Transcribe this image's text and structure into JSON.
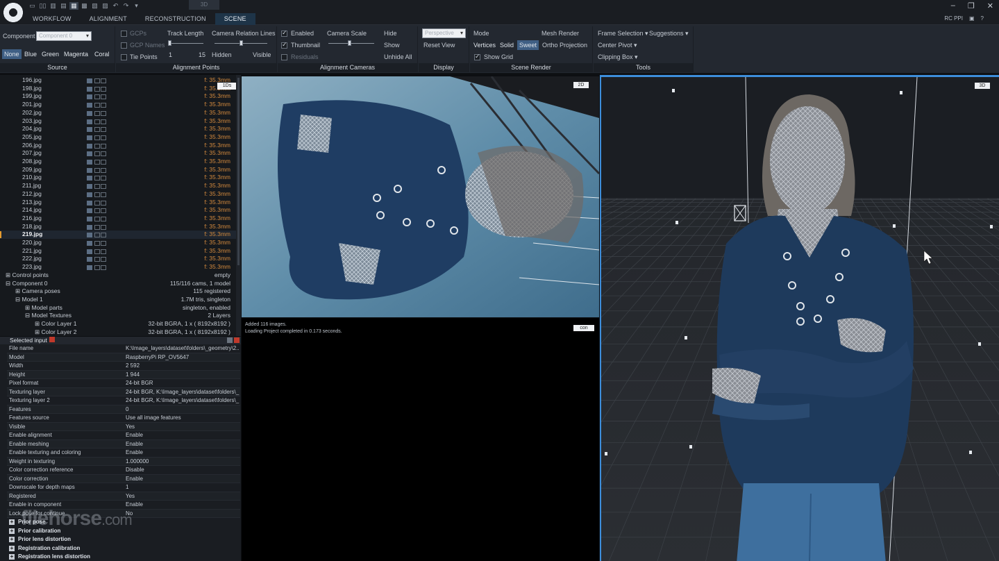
{
  "app": {
    "tab_hint": "3D",
    "menu_tabs": [
      "WORKFLOW",
      "ALIGNMENT",
      "RECONSTRUCTION",
      "SCENE"
    ],
    "active_tab": "SCENE",
    "window_controls": [
      "–",
      "❐",
      "✕"
    ],
    "right_corner": [
      "RC PPI",
      "▣",
      "?"
    ]
  },
  "ribbon": {
    "source": {
      "label": "Source",
      "component_label": "Component",
      "component_value": "Component 0",
      "colors": [
        "None",
        "Blue",
        "Green",
        "Magenta",
        "Coral"
      ],
      "selected_color": "None"
    },
    "alignment_points": {
      "label": "Alignment Points",
      "gcps": "GCPs",
      "gcp_names": "GCP Names",
      "tie_points": "Tie Points",
      "track_length": "Track Length",
      "track_min": "1",
      "track_max": "15",
      "camera_relation_lines": "Camera Relation Lines",
      "hidden": "Hidden",
      "visible": "Visible"
    },
    "alignment_cameras": {
      "label": "Alignment Cameras",
      "enabled": "Enabled",
      "thumbnail": "Thumbnail",
      "residuals": "Residuals",
      "camera_scale": "Camera Scale",
      "hide": "Hide",
      "show": "Show",
      "unhide_all": "Unhide All"
    },
    "display": {
      "label": "Display",
      "projection_value": "Perspective",
      "reset_view": "Reset View"
    },
    "scene_render": {
      "label": "Scene Render",
      "mode": "Mode",
      "mesh_render": "Mesh Render",
      "vertices": "Vertices",
      "solid": "Solid",
      "sweet": "Sweet",
      "ortho_projection": "Ortho Projection",
      "show_grid": "Show Grid"
    },
    "tools": {
      "label": "Tools",
      "frame_selection": "Frame Selection",
      "suggestions": "Suggestions",
      "center_pivot": "Center Pivot",
      "clipping_box": "Clipping Box"
    }
  },
  "tree": {
    "badge": "1Ds",
    "images": [
      {
        "name": "196.jpg",
        "focal": "f: 35.3mm"
      },
      {
        "name": "198.jpg",
        "focal": "f: 35.3mm"
      },
      {
        "name": "199.jpg",
        "focal": "f: 35.3mm"
      },
      {
        "name": "201.jpg",
        "focal": "f: 35.3mm"
      },
      {
        "name": "202.jpg",
        "focal": "f: 35.3mm"
      },
      {
        "name": "203.jpg",
        "focal": "f: 35.3mm"
      },
      {
        "name": "204.jpg",
        "focal": "f: 35.3mm"
      },
      {
        "name": "205.jpg",
        "focal": "f: 35.3mm"
      },
      {
        "name": "206.jpg",
        "focal": "f: 35.3mm"
      },
      {
        "name": "207.jpg",
        "focal": "f: 35.3mm"
      },
      {
        "name": "208.jpg",
        "focal": "f: 35.3mm"
      },
      {
        "name": "209.jpg",
        "focal": "f: 35.3mm"
      },
      {
        "name": "210.jpg",
        "focal": "f: 35.3mm"
      },
      {
        "name": "211.jpg",
        "focal": "f: 35.3mm"
      },
      {
        "name": "212.jpg",
        "focal": "f: 35.3mm"
      },
      {
        "name": "213.jpg",
        "focal": "f: 35.3mm"
      },
      {
        "name": "214.jpg",
        "focal": "f: 35.3mm"
      },
      {
        "name": "216.jpg",
        "focal": "f: 35.3mm"
      },
      {
        "name": "218.jpg",
        "focal": "f: 35.3mm"
      },
      {
        "name": "219.jpg",
        "focal": "f: 35.3mm"
      },
      {
        "name": "220.jpg",
        "focal": "f: 35.3mm"
      },
      {
        "name": "221.jpg",
        "focal": "f: 35.3mm"
      },
      {
        "name": "222.jpg",
        "focal": "f: 35.3mm"
      },
      {
        "name": "223.jpg",
        "focal": "f: 35.3mm"
      }
    ],
    "selected_image": "219.jpg",
    "structure": [
      {
        "name": "⊞ Control points",
        "value": "empty",
        "indent": 8
      },
      {
        "name": "⊟ Component 0",
        "value": "115/116 cams, 1 model",
        "indent": 8
      },
      {
        "name": "⊞ Camera poses",
        "value": "115 registered",
        "indent": 22
      },
      {
        "name": "⊟ Model 1",
        "value": "1.7M tris, singleton",
        "indent": 22
      },
      {
        "name": "⊞ Model parts",
        "value": "singleton, enabled",
        "indent": 36
      },
      {
        "name": "⊟ Model Textures",
        "value": "2 Layers",
        "indent": 36
      },
      {
        "name": "⊞ Color Layer 1",
        "value": "32-bit BGRA, 1 x ( 8192x8192 )",
        "indent": 50
      },
      {
        "name": "⊞ Color Layer 2",
        "value": "32-bit BGRA, 1 x ( 8192x8192 )",
        "indent": 50
      }
    ]
  },
  "properties": {
    "title": "Selected input",
    "rows": [
      {
        "k": "File name",
        "v": "K:\\Image_layers\\dataset\\folders\\_geometry\\2..."
      },
      {
        "k": "Model",
        "v": "RaspberryPi RP_OV5647"
      },
      {
        "k": "Width",
        "v": "2 592"
      },
      {
        "k": "Height",
        "v": "1 944"
      },
      {
        "k": "Pixel format",
        "v": "24-bit BGR"
      },
      {
        "k": "Texturing layer",
        "v": "24-bit BGR, K:\\Image_layers\\dataset\\folders\\_..."
      },
      {
        "k": "Texturing layer 2",
        "v": "24-bit BGR, K:\\Image_layers\\dataset\\folders\\_..."
      },
      {
        "k": "Features",
        "v": "0"
      },
      {
        "k": "Features source",
        "v": "Use all image features"
      },
      {
        "k": "Visible",
        "v": "Yes"
      },
      {
        "k": "Enable alignment",
        "v": "Enable"
      },
      {
        "k": "Enable meshing",
        "v": "Enable"
      },
      {
        "k": "Enable texturing and coloring",
        "v": "Enable"
      },
      {
        "k": "Weight in texturing",
        "v": "1.000000"
      },
      {
        "k": "Color correction reference",
        "v": "Disable"
      },
      {
        "k": "Color correction",
        "v": "Enable"
      },
      {
        "k": "Downscale for depth maps",
        "v": "1"
      },
      {
        "k": "Registered",
        "v": "Yes"
      },
      {
        "k": "Enable in component",
        "v": "Enable"
      },
      {
        "k": "Lock pose for continue",
        "v": "No"
      }
    ],
    "sections": [
      "Prior pose",
      "Prior calibration",
      "Prior lens distortion",
      "Registration calibration",
      "Registration lens distortion"
    ],
    "watermark": "filehorse",
    "watermark_suffix": ".com"
  },
  "view2d": {
    "tag": "2D"
  },
  "console": {
    "tag": "con",
    "lines": [
      "Added 116 images.",
      "Loading Project completed in 0.173 seconds."
    ]
  },
  "view3d": {
    "tag": "3D"
  },
  "colors": {
    "accent": "#3d8edb",
    "focal_text": "#d38a3e",
    "selection_marker": "#e59b2f",
    "sweater": "#1e3a5c"
  }
}
